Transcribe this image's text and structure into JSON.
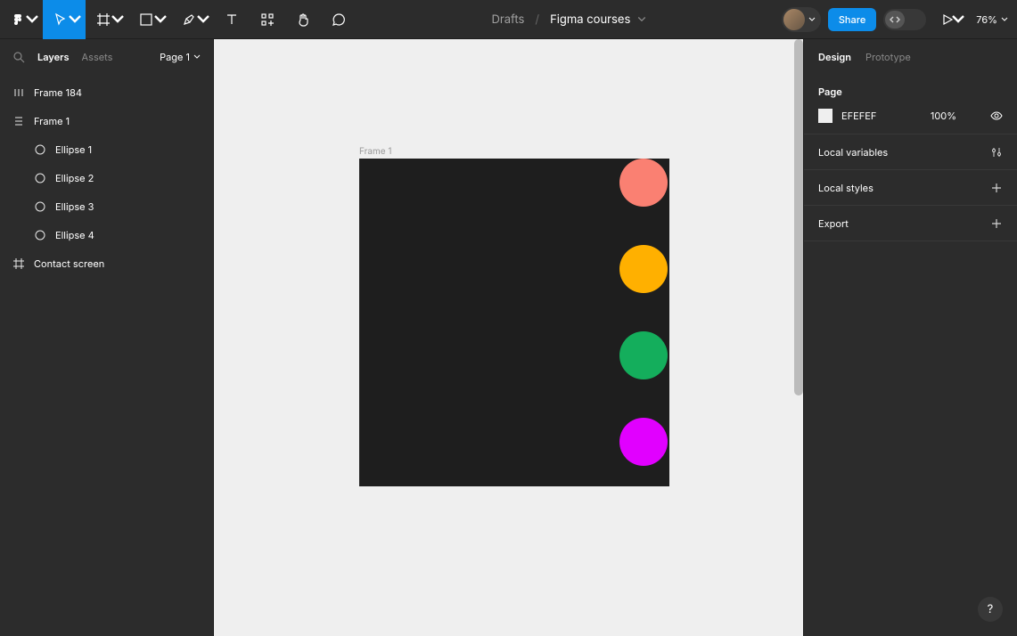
{
  "toolbar": {
    "breadcrumb_parent": "Drafts",
    "breadcrumb_current": "Figma courses",
    "share_label": "Share",
    "zoom": "76%"
  },
  "left_panel": {
    "tab_layers": "Layers",
    "tab_assets": "Assets",
    "page_selector": "Page 1",
    "layers": [
      {
        "icon": "autolayout",
        "name": "Frame 184",
        "indent": 0
      },
      {
        "icon": "autolayout-v",
        "name": "Frame 1",
        "indent": 0
      },
      {
        "icon": "ellipse",
        "name": "Ellipse 1",
        "indent": 1
      },
      {
        "icon": "ellipse",
        "name": "Ellipse 2",
        "indent": 1
      },
      {
        "icon": "ellipse",
        "name": "Ellipse 3",
        "indent": 1
      },
      {
        "icon": "ellipse",
        "name": "Ellipse 4",
        "indent": 1
      },
      {
        "icon": "frame",
        "name": "Contact screen",
        "indent": 0
      }
    ]
  },
  "canvas": {
    "frame_label": "Frame 1",
    "background": "#EFEFEF",
    "ellipses": [
      {
        "color": "#FA8072"
      },
      {
        "color": "#FFB000"
      },
      {
        "color": "#14AE5C"
      },
      {
        "color": "#E100FF"
      }
    ]
  },
  "right_panel": {
    "tab_design": "Design",
    "tab_prototype": "Prototype",
    "page_section_title": "Page",
    "page_color": "EFEFEF",
    "page_opacity": "100%",
    "local_variables": "Local variables",
    "local_styles": "Local styles",
    "export": "Export"
  },
  "help": "?"
}
